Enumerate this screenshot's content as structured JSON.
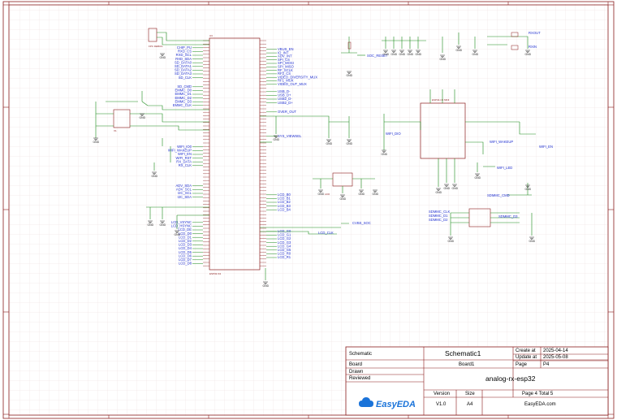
{
  "title_block": {
    "labels": {
      "schematic": "Schematic",
      "board": "Board",
      "drawn": "Drawn",
      "reviewed": "Reviewed",
      "create_at": "Create at",
      "update_at": "Update at",
      "page": "Page",
      "version": "Version",
      "size": "Size"
    },
    "values": {
      "schematic_name": "Schematic1",
      "board_name": "Board1",
      "create_date": "2025-04-14",
      "update_date": "2025-05-08",
      "page_id": "P4",
      "project_name": "analog-rx-esp32",
      "version": "V1.0",
      "size": "A4",
      "page_of_total": "Page 4  Total 5",
      "website": "EasyEDA.com",
      "logo_text": "EasyEDA"
    }
  },
  "colors": {
    "wire": "#1a8a1a",
    "border": "#8a1c1c",
    "net_label": "#1f2fd0",
    "grid": "#e8d6d6",
    "logo": "#1a73d9"
  },
  "net_labels": {
    "mcu_left": [
      "CHIP_PU",
      "RXD_CS",
      "RXD_SCL",
      "RXD_SDA",
      "SD_DATA0",
      "SD_DATA1",
      "SD_DATA2",
      "SD_DATA3",
      "SD_CLK",
      "SD_CMD",
      "EMMC_D0",
      "EMMC_D1",
      "EMMC_D2",
      "EMMC_D3",
      "EMMC_CLK",
      "WIFI_IO0",
      "WIFI_WAKEUP",
      "WIFI_EN",
      "WIFI_RST",
      "RX_DATA",
      "RX_CLK",
      "ADV_SDA",
      "ADV_SCL",
      "I2C_SCL",
      "I2C_SDA",
      "LCD_VSYNC",
      "LCD_HSYNC",
      "LCD_DE",
      "LCD_D0",
      "LCD_D1",
      "LCD_D2",
      "LCD_D3",
      "LCD_D4",
      "LCD_D5",
      "LCD_D6",
      "LCD_D7",
      "LCD_D8"
    ],
    "mcu_right_top": [
      "VBUS_EN",
      "IO_INT",
      "ADV_INT",
      "SPI_CS",
      "SPI_MOSI",
      "SPI_MISO",
      "RF_SCLK",
      "RF2_CS",
      "VIDEO_DIVERSITY_MUX",
      "RF1_MUX",
      "VIDEO_OUT_MUX"
    ],
    "mcu_right_usb": [
      "USB_D-",
      "USB_D+",
      "USB2_D-",
      "USB2_D+",
      "OVER_OUT",
      "SYS_VIEWSEL"
    ],
    "mcu_right_lcd": [
      "LCD_B0",
      "LCD_B1",
      "LCD_B2",
      "LCD_B3",
      "LCD_B4",
      "LCD_G0",
      "LCD_G1",
      "LCD_G2",
      "LCD_G3",
      "LCD_G4",
      "LCD_G5",
      "LCD_R0",
      "LCD_R1"
    ],
    "misc": [
      "SOC_RESET",
      "LCD_CLK",
      "CVBS_SOC",
      "WIFI_WAKEUP",
      "WIFI_EN",
      "WIFI_LED",
      "WIFI_DIO",
      "SD_DATA1",
      "SDMMC_CMD",
      "SDMMC_CLK",
      "SDMMC_D1",
      "SDMMC_D2",
      "SDMMC_D3",
      "RXOUT",
      "RXIN"
    ]
  },
  "gnd_label": "GND"
}
